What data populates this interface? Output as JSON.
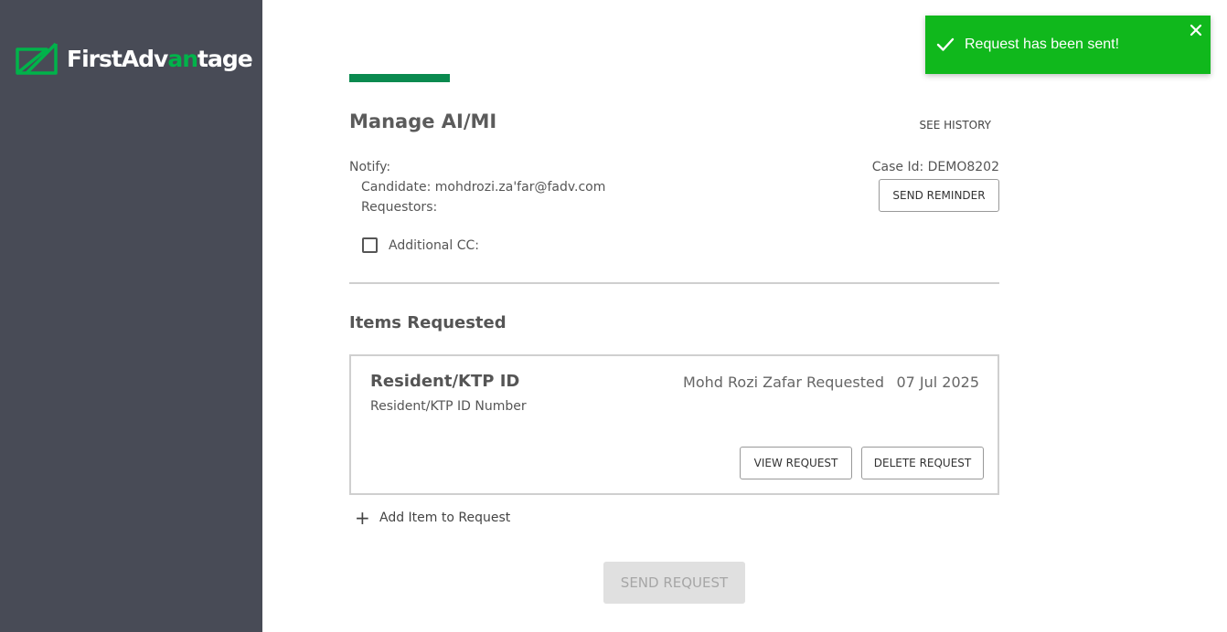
{
  "brand": {
    "name_part1": "FirstAdv",
    "name_highlight": "an",
    "name_part2": "tage",
    "accent_color": "#00b34a"
  },
  "header": {
    "title": "Manage AI/MI",
    "see_history_label": "SEE HISTORY"
  },
  "notify": {
    "label": "Notify:",
    "candidate": "Candidate: mohdrozi.za'far@fadv.com",
    "requestors": "Requestors:",
    "additional_cc_label": "Additional CC:",
    "additional_cc_checked": false
  },
  "case": {
    "case_id": "Case Id: DEMO8202",
    "send_reminder_label": "SEND REMINDER"
  },
  "items_section": {
    "title": "Items Requested",
    "items": [
      {
        "name": "Resident/KTP ID",
        "description": "Resident/KTP ID Number",
        "requester": "Mohd Rozi Zafar Requested",
        "date": "07 Jul 2025",
        "view_label": "VIEW REQUEST",
        "delete_label": "DELETE REQUEST"
      }
    ],
    "add_item_label": "Add Item to Request"
  },
  "footer": {
    "send_request_label": "SEND REQUEST"
  },
  "toast": {
    "message": "Request has been sent!",
    "color": "#10b81c"
  },
  "colors": {
    "sidebar": "#484b56",
    "accent_bar": "#0a8a4f"
  }
}
